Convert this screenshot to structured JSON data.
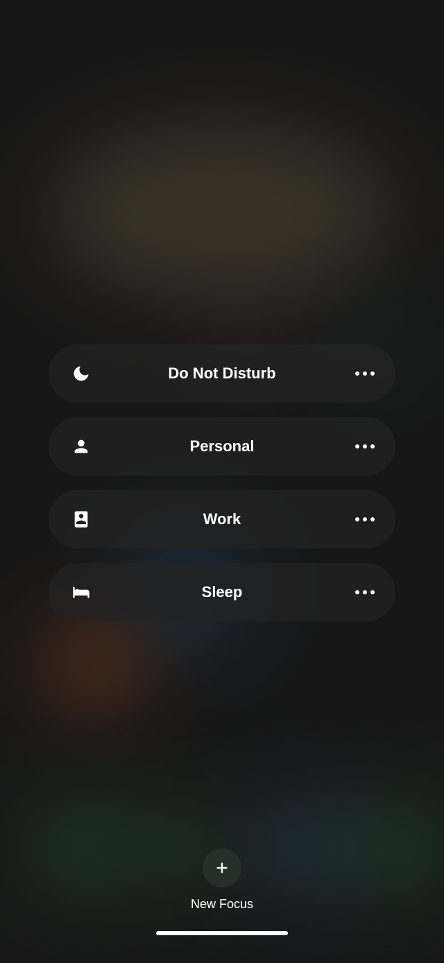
{
  "focus_modes": [
    {
      "id": "do-not-disturb",
      "label": "Do Not Disturb",
      "icon": "moon"
    },
    {
      "id": "personal",
      "label": "Personal",
      "icon": "person"
    },
    {
      "id": "work",
      "label": "Work",
      "icon": "badge"
    },
    {
      "id": "sleep",
      "label": "Sleep",
      "icon": "bed"
    }
  ],
  "new_focus": {
    "label": "New Focus"
  }
}
